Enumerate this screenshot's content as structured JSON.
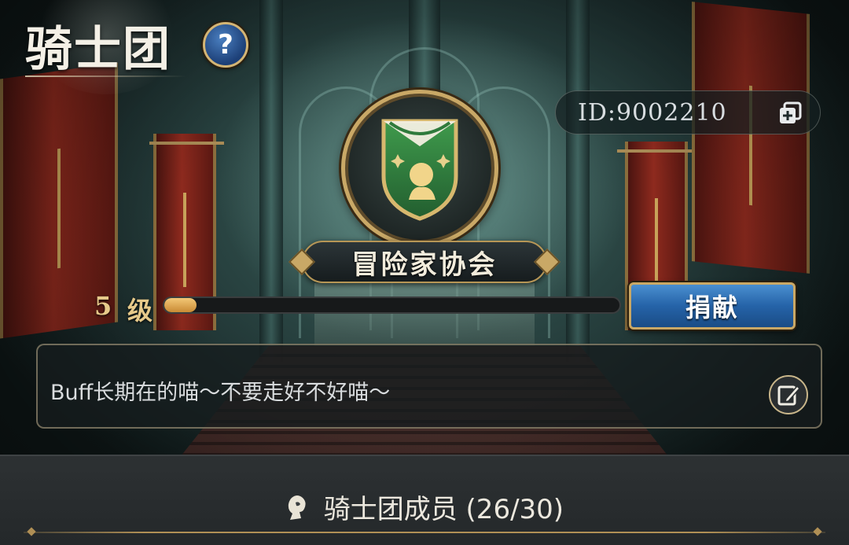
{
  "header": {
    "title": "骑士团",
    "help_icon": "question-mark-icon",
    "help_label": "?"
  },
  "guild": {
    "id_text": "ID:9002210",
    "copy_icon": "copy-plus-icon",
    "emblem_icon": "green-shield-crest-icon",
    "name": "冒险家协会",
    "level_number": "5",
    "level_unit": "级",
    "level_progress": 0.07
  },
  "actions": {
    "donate_label": "捐献"
  },
  "notice": {
    "text": "Buff长期在的喵～不要走好不好喵～",
    "edit_icon": "edit-pen-icon"
  },
  "members": {
    "icon": "member-silhouette-icon",
    "label": "骑士团成员 (26/30)"
  },
  "colors": {
    "gold_trim": "#c9a866",
    "level_fill": "#e8b25c",
    "donate_button": "#2563a8",
    "shield_green": "#2f7a3c"
  }
}
